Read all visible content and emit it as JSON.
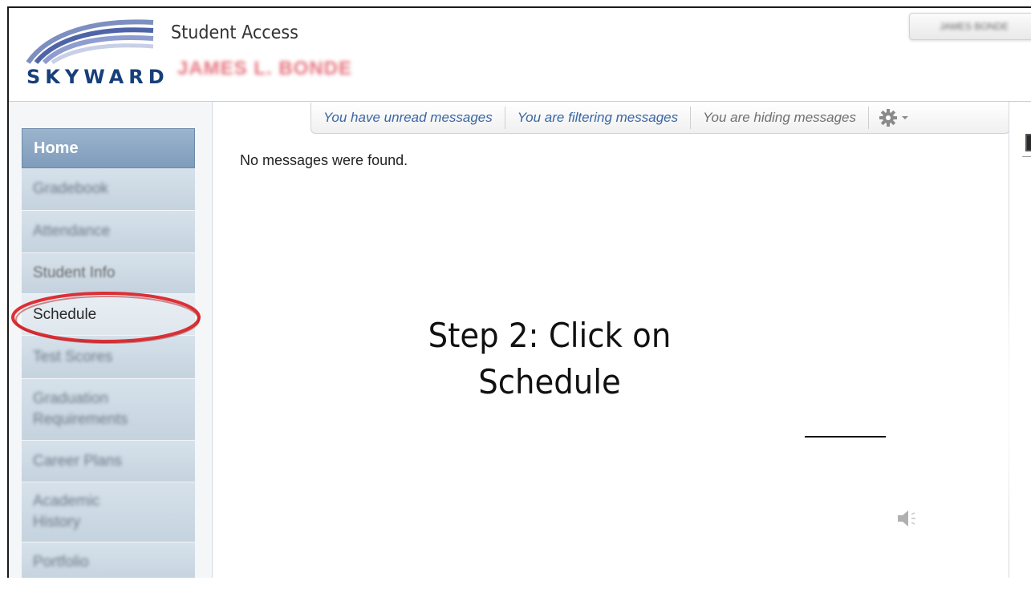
{
  "app": {
    "brand": "SKYWARD",
    "title": "Student Access",
    "student_name": "JAMES L. BONDE",
    "account_label": "JAMES BONDE"
  },
  "sidebar": {
    "items": [
      {
        "label": "Home"
      },
      {
        "label": "Gradebook"
      },
      {
        "label": "Attendance"
      },
      {
        "label": "Student Info"
      },
      {
        "label": "Schedule"
      },
      {
        "label": "Test Scores"
      },
      {
        "label": "Graduation Requirements"
      },
      {
        "label": "Career Plans"
      },
      {
        "label": "Academic History"
      },
      {
        "label": "Portfolio"
      }
    ]
  },
  "message_tabs": {
    "unread": "You have unread messages",
    "filtering": "You are filtering messages",
    "hiding": "You are hiding messages",
    "settings_icon": "gear-icon"
  },
  "main": {
    "empty_text": "No messages were found."
  },
  "annotation": {
    "line1": "Step 2: Click on",
    "line2": "Schedule",
    "highlight_color": "#d9262b"
  },
  "colors": {
    "brand_blue": "#173f7a",
    "link_blue": "#3a66a4",
    "nav_home": "#8ea8c6"
  }
}
